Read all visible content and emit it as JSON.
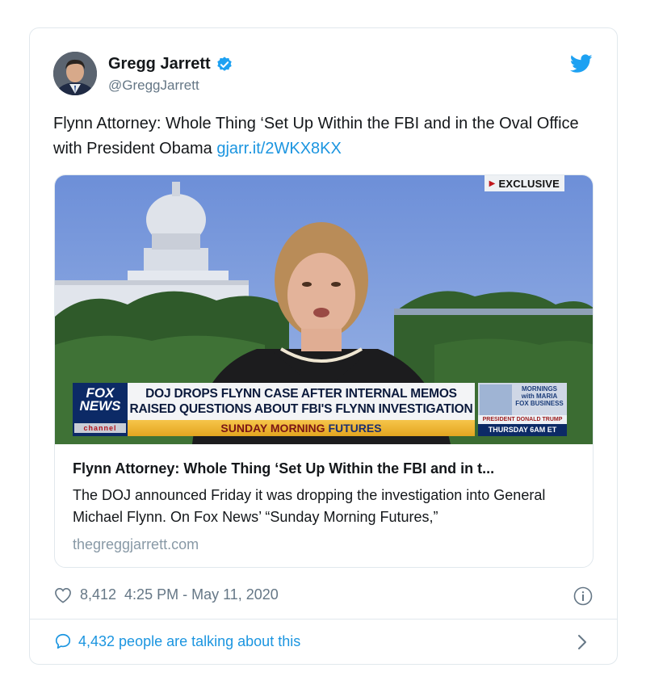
{
  "author": {
    "name": "Gregg Jarrett",
    "handle": "@GreggJarrett"
  },
  "tweet": {
    "text": "Flynn Attorney: Whole Thing ‘Set Up Within the FBI and in the Oval Office with President Obama",
    "link": "gjarr.it/2WKX8KX"
  },
  "media": {
    "badge": "EXCLUSIVE",
    "logo_line1": "FOX",
    "logo_line2": "NEWS",
    "logo_line3": "channel",
    "headline_line1": "DOJ DROPS FLYNN CASE AFTER INTERNAL MEMOS",
    "headline_line2": "RAISED QUESTIONS ABOUT FBI'S FLYNN INVESTIGATION",
    "subbar_part1": "SUNDAY MORNING",
    "subbar_part2": "FUTURES",
    "promo_show_line1": "MORNINGS",
    "promo_show_line2": "with MARIA",
    "promo_show_line3": "FOX BUSINESS",
    "promo_guest": "PRESIDENT DONALD TRUMP",
    "promo_time": "THURSDAY 6AM ET"
  },
  "link_card": {
    "title": "Flynn Attorney: Whole Thing ‘Set Up Within the FBI and in t...",
    "description": "The DOJ announced Friday it was dropping the investigation into General Michael Flynn. On Fox News’ “Sunday Morning Futures,”",
    "domain": "thegreggjarrett.com"
  },
  "meta": {
    "likes": "8,412",
    "timestamp": "4:25 PM - May 11, 2020"
  },
  "footer": {
    "talking": "4,432 people are talking about this"
  },
  "colors": {
    "link_blue": "#1b95e0",
    "muted": "#657786",
    "border": "#e1e8ed",
    "fox_navy": "#0c2a66"
  },
  "icons": [
    "verified-badge-icon",
    "twitter-bird-icon",
    "heart-icon",
    "info-icon",
    "speech-bubble-icon",
    "chevron-right-icon"
  ]
}
